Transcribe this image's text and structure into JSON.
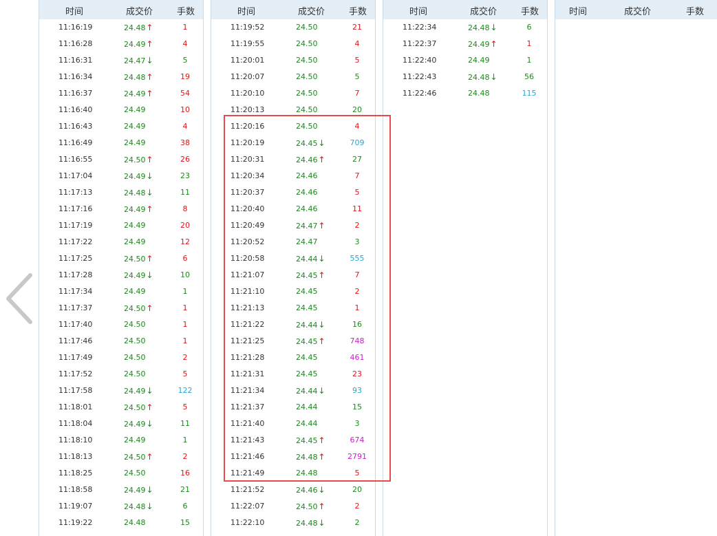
{
  "headers": {
    "time": "时间",
    "price": "成交价",
    "volume": "手数"
  },
  "colors": {
    "up": "#e0141a",
    "down": "#1a8a1a",
    "large": "#25a7d6",
    "huge": "#c81fc8",
    "header_bg": "#e4eef7"
  },
  "nav": {
    "prev_icon": "chevron-left-icon"
  },
  "columns": [
    [
      {
        "time": "11:16:19",
        "price": "24.48",
        "dir": "up",
        "vol": "1",
        "vc": "red"
      },
      {
        "time": "11:16:28",
        "price": "24.49",
        "dir": "up",
        "vol": "4",
        "vc": "red"
      },
      {
        "time": "11:16:31",
        "price": "24.47",
        "dir": "down",
        "vol": "5",
        "vc": "green"
      },
      {
        "time": "11:16:34",
        "price": "24.48",
        "dir": "up",
        "vol": "19",
        "vc": "red"
      },
      {
        "time": "11:16:37",
        "price": "24.49",
        "dir": "up",
        "vol": "54",
        "vc": "red"
      },
      {
        "time": "11:16:40",
        "price": "24.49",
        "dir": "",
        "vol": "10",
        "vc": "red"
      },
      {
        "time": "11:16:43",
        "price": "24.49",
        "dir": "",
        "vol": "4",
        "vc": "red"
      },
      {
        "time": "11:16:49",
        "price": "24.49",
        "dir": "",
        "vol": "38",
        "vc": "red"
      },
      {
        "time": "11:16:55",
        "price": "24.50",
        "dir": "up",
        "vol": "26",
        "vc": "red"
      },
      {
        "time": "11:17:04",
        "price": "24.49",
        "dir": "down",
        "vol": "23",
        "vc": "green"
      },
      {
        "time": "11:17:13",
        "price": "24.48",
        "dir": "down",
        "vol": "11",
        "vc": "green"
      },
      {
        "time": "11:17:16",
        "price": "24.49",
        "dir": "up",
        "vol": "8",
        "vc": "red"
      },
      {
        "time": "11:17:19",
        "price": "24.49",
        "dir": "",
        "vol": "20",
        "vc": "red"
      },
      {
        "time": "11:17:22",
        "price": "24.49",
        "dir": "",
        "vol": "12",
        "vc": "red"
      },
      {
        "time": "11:17:25",
        "price": "24.50",
        "dir": "up",
        "vol": "6",
        "vc": "red"
      },
      {
        "time": "11:17:28",
        "price": "24.49",
        "dir": "down",
        "vol": "10",
        "vc": "green"
      },
      {
        "time": "11:17:34",
        "price": "24.49",
        "dir": "",
        "vol": "1",
        "vc": "green"
      },
      {
        "time": "11:17:37",
        "price": "24.50",
        "dir": "up",
        "vol": "1",
        "vc": "red"
      },
      {
        "time": "11:17:40",
        "price": "24.50",
        "dir": "",
        "vol": "1",
        "vc": "red"
      },
      {
        "time": "11:17:46",
        "price": "24.50",
        "dir": "",
        "vol": "1",
        "vc": "red"
      },
      {
        "time": "11:17:49",
        "price": "24.50",
        "dir": "",
        "vol": "2",
        "vc": "red"
      },
      {
        "time": "11:17:52",
        "price": "24.50",
        "dir": "",
        "vol": "5",
        "vc": "red"
      },
      {
        "time": "11:17:58",
        "price": "24.49",
        "dir": "down",
        "vol": "122",
        "vc": "blue"
      },
      {
        "time": "11:18:01",
        "price": "24.50",
        "dir": "up",
        "vol": "5",
        "vc": "red"
      },
      {
        "time": "11:18:04",
        "price": "24.49",
        "dir": "down",
        "vol": "11",
        "vc": "green"
      },
      {
        "time": "11:18:10",
        "price": "24.49",
        "dir": "",
        "vol": "1",
        "vc": "green"
      },
      {
        "time": "11:18:13",
        "price": "24.50",
        "dir": "up",
        "vol": "2",
        "vc": "red"
      },
      {
        "time": "11:18:25",
        "price": "24.50",
        "dir": "",
        "vol": "16",
        "vc": "red"
      },
      {
        "time": "11:18:58",
        "price": "24.49",
        "dir": "down",
        "vol": "21",
        "vc": "green"
      },
      {
        "time": "11:19:07",
        "price": "24.48",
        "dir": "down",
        "vol": "6",
        "vc": "green"
      },
      {
        "time": "11:19:22",
        "price": "24.48",
        "dir": "",
        "vol": "15",
        "vc": "green"
      }
    ],
    [
      {
        "time": "11:19:52",
        "price": "24.50",
        "dir": "",
        "vol": "21",
        "vc": "red"
      },
      {
        "time": "11:19:55",
        "price": "24.50",
        "dir": "",
        "vol": "4",
        "vc": "red"
      },
      {
        "time": "11:20:01",
        "price": "24.50",
        "dir": "",
        "vol": "5",
        "vc": "red"
      },
      {
        "time": "11:20:07",
        "price": "24.50",
        "dir": "",
        "vol": "5",
        "vc": "green"
      },
      {
        "time": "11:20:10",
        "price": "24.50",
        "dir": "",
        "vol": "7",
        "vc": "red"
      },
      {
        "time": "11:20:13",
        "price": "24.50",
        "dir": "",
        "vol": "20",
        "vc": "green"
      },
      {
        "time": "11:20:16",
        "price": "24.50",
        "dir": "",
        "vol": "4",
        "vc": "red"
      },
      {
        "time": "11:20:19",
        "price": "24.45",
        "dir": "down",
        "vol": "709",
        "vc": "blue"
      },
      {
        "time": "11:20:31",
        "price": "24.46",
        "dir": "up",
        "vol": "27",
        "vc": "green"
      },
      {
        "time": "11:20:34",
        "price": "24.46",
        "dir": "",
        "vol": "7",
        "vc": "red"
      },
      {
        "time": "11:20:37",
        "price": "24.46",
        "dir": "",
        "vol": "5",
        "vc": "red"
      },
      {
        "time": "11:20:40",
        "price": "24.46",
        "dir": "",
        "vol": "11",
        "vc": "red"
      },
      {
        "time": "11:20:49",
        "price": "24.47",
        "dir": "up",
        "vol": "2",
        "vc": "red"
      },
      {
        "time": "11:20:52",
        "price": "24.47",
        "dir": "",
        "vol": "3",
        "vc": "green"
      },
      {
        "time": "11:20:58",
        "price": "24.44",
        "dir": "down",
        "vol": "555",
        "vc": "blue"
      },
      {
        "time": "11:21:07",
        "price": "24.45",
        "dir": "up",
        "vol": "7",
        "vc": "red"
      },
      {
        "time": "11:21:10",
        "price": "24.45",
        "dir": "",
        "vol": "2",
        "vc": "red"
      },
      {
        "time": "11:21:13",
        "price": "24.45",
        "dir": "",
        "vol": "1",
        "vc": "red"
      },
      {
        "time": "11:21:22",
        "price": "24.44",
        "dir": "down",
        "vol": "16",
        "vc": "green"
      },
      {
        "time": "11:21:25",
        "price": "24.45",
        "dir": "up",
        "vol": "748",
        "vc": "purple"
      },
      {
        "time": "11:21:28",
        "price": "24.45",
        "dir": "",
        "vol": "461",
        "vc": "purple"
      },
      {
        "time": "11:21:31",
        "price": "24.45",
        "dir": "",
        "vol": "23",
        "vc": "red"
      },
      {
        "time": "11:21:34",
        "price": "24.44",
        "dir": "down",
        "vol": "93",
        "vc": "blue"
      },
      {
        "time": "11:21:37",
        "price": "24.44",
        "dir": "",
        "vol": "15",
        "vc": "green"
      },
      {
        "time": "11:21:40",
        "price": "24.44",
        "dir": "",
        "vol": "3",
        "vc": "green"
      },
      {
        "time": "11:21:43",
        "price": "24.45",
        "dir": "up",
        "vol": "674",
        "vc": "purple"
      },
      {
        "time": "11:21:46",
        "price": "24.48",
        "dir": "up",
        "vol": "2791",
        "vc": "purple"
      },
      {
        "time": "11:21:49",
        "price": "24.48",
        "dir": "",
        "vol": "5",
        "vc": "red"
      },
      {
        "time": "11:21:52",
        "price": "24.46",
        "dir": "down",
        "vol": "20",
        "vc": "green"
      },
      {
        "time": "11:22:07",
        "price": "24.50",
        "dir": "up",
        "vol": "2",
        "vc": "red"
      },
      {
        "time": "11:22:10",
        "price": "24.48",
        "dir": "down",
        "vol": "2",
        "vc": "green"
      }
    ],
    [
      {
        "time": "11:22:34",
        "price": "24.48",
        "dir": "down",
        "vol": "6",
        "vc": "green"
      },
      {
        "time": "11:22:37",
        "price": "24.49",
        "dir": "up",
        "vol": "1",
        "vc": "red"
      },
      {
        "time": "11:22:40",
        "price": "24.49",
        "dir": "",
        "vol": "1",
        "vc": "green"
      },
      {
        "time": "11:22:43",
        "price": "24.48",
        "dir": "down",
        "vol": "56",
        "vc": "green"
      },
      {
        "time": "11:22:46",
        "price": "24.48",
        "dir": "",
        "vol": "115",
        "vc": "blue"
      }
    ],
    []
  ]
}
